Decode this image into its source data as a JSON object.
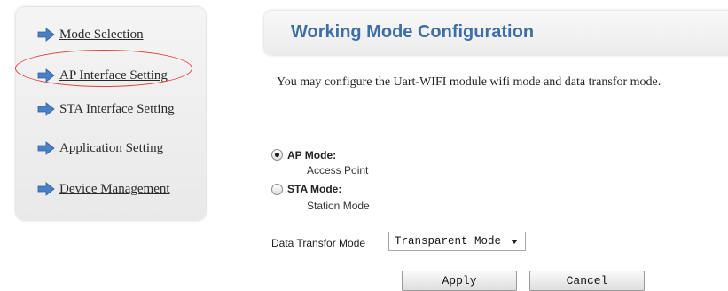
{
  "sidebar": {
    "items": [
      {
        "label": "Mode Selection",
        "icon": "arrow-right-icon"
      },
      {
        "label": "AP Interface Setting",
        "icon": "arrow-right-icon"
      },
      {
        "label": "STA Interface Setting",
        "icon": "arrow-right-icon"
      },
      {
        "label": "Application Setting",
        "icon": "arrow-right-icon"
      },
      {
        "label": "Device Management",
        "icon": "arrow-right-icon"
      }
    ],
    "highlighted_item": "AP Interface Setting"
  },
  "main": {
    "title": "Working Mode Configuration",
    "description": "You may configure the Uart-WIFI module wifi mode and data transfor mode.",
    "modes": [
      {
        "title": "AP Mode:",
        "subtitle": "Access Point",
        "checked": true
      },
      {
        "title": "STA Mode:",
        "subtitle": "Station Mode",
        "checked": false
      }
    ],
    "data_transfer": {
      "label": "Data Transfor Mode",
      "selected": "Transparent Mode"
    },
    "buttons": {
      "apply": "Apply",
      "cancel": "Cancel"
    }
  },
  "colors": {
    "title": "#3d6fa6",
    "arrow_icon": "#4a80c6",
    "highlight_ring": "#e0403a"
  }
}
